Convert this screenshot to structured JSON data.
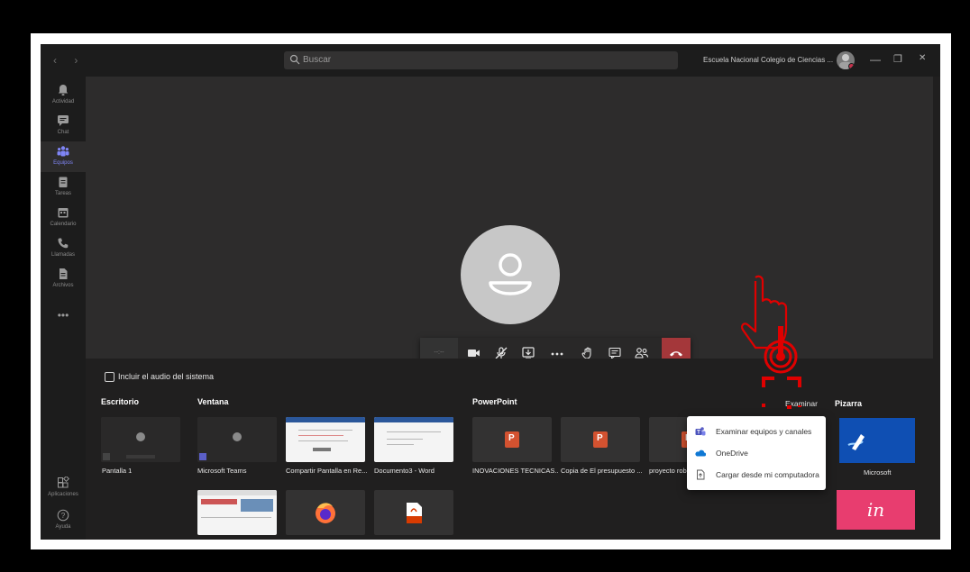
{
  "titlebar": {
    "nav": "‹  ›",
    "search_placeholder": "Buscar",
    "organization": "Escuela Nacional Colegio de Ciencias ... ⌄",
    "minimize": "—",
    "maximize": "❐",
    "close": "✕"
  },
  "rail": {
    "items": [
      {
        "label": "Actividad",
        "icon": "bell-icon"
      },
      {
        "label": "Chat",
        "icon": "chat-icon"
      },
      {
        "label": "Equipos",
        "icon": "teams-icon",
        "active": true
      },
      {
        "label": "Tareas",
        "icon": "assignments-icon"
      },
      {
        "label": "Calendario",
        "icon": "calendar-icon"
      },
      {
        "label": "Llamadas",
        "icon": "phone-icon"
      },
      {
        "label": "Archivos",
        "icon": "files-icon"
      }
    ],
    "more": "•••",
    "apps_label": "Aplicaciones",
    "help_label": "Ayuda"
  },
  "call": {
    "timer": "--:--"
  },
  "share": {
    "system_audio_label": "Incluir el audio del sistema",
    "sections": {
      "desktop": "Escritorio",
      "window": "Ventana",
      "powerpoint": "PowerPoint",
      "browse": "Examinar",
      "whiteboard": "Pizarra"
    },
    "desktop_tiles": [
      {
        "label": "Pantalla 1"
      }
    ],
    "window_tiles": [
      {
        "label": "Microsoft Teams"
      },
      {
        "label": "Compartir Pantalla en Re..."
      },
      {
        "label": "Documento3 - Word"
      }
    ],
    "powerpoint_tiles": [
      {
        "label": "INOVACIONES TECNICAS..."
      },
      {
        "label": "Copia de El presupuesto ..."
      },
      {
        "label": "proyecto robotica.pptx"
      }
    ],
    "browse_menu": [
      {
        "label": "Examinar equipos y canales",
        "icon": "teams-icon"
      },
      {
        "label": "OneDrive",
        "icon": "onedrive-icon"
      },
      {
        "label": "Cargar desde mi computadora",
        "icon": "upload-icon"
      }
    ],
    "whiteboard_label": "Microsoft",
    "invision_label": "in"
  },
  "colors": {
    "accent": "#7f85f5",
    "hangup": "#a4373a",
    "annotation": "#e00000"
  }
}
